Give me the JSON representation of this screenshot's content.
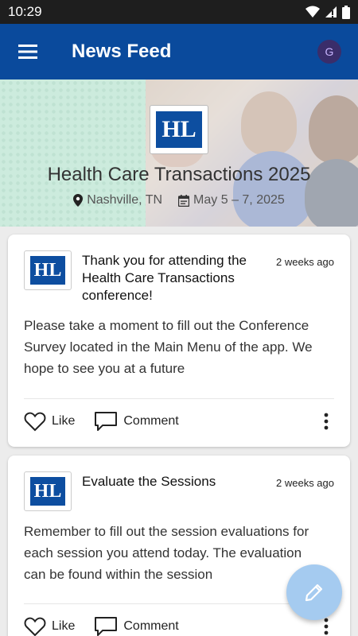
{
  "status_bar": {
    "time": "10:29"
  },
  "app_bar": {
    "title": "News Feed",
    "avatar_initial": "G"
  },
  "event": {
    "title": "Health Care Transactions 2025",
    "location": "Nashville, TN",
    "dates": "May 5 – 7, 2025"
  },
  "posts": [
    {
      "title": "Thank you for attending the Health Care Transactions conference!",
      "time": "2 weeks ago",
      "body": "Please take a moment to fill out the Conference Survey located in the Main Menu of the app. We hope to see you at a future",
      "like_label": "Like",
      "comment_label": "Comment"
    },
    {
      "title": "Evaluate the Sessions",
      "time": "2 weeks ago",
      "body": "Remember to fill out the session evaluations for each session you attend today. The evaluation can be found within the session",
      "like_label": "Like",
      "comment_label": "Comment"
    }
  ],
  "colors": {
    "app_bar": "#0a4a9c",
    "logo_blue": "#0d4ea0",
    "fab": "#a5cbf0"
  },
  "icons": [
    "menu-icon",
    "location-pin-icon",
    "calendar-icon",
    "heart-icon",
    "comment-icon",
    "more-vert-icon",
    "pencil-icon",
    "wifi-icon",
    "signal-icon",
    "battery-icon"
  ]
}
